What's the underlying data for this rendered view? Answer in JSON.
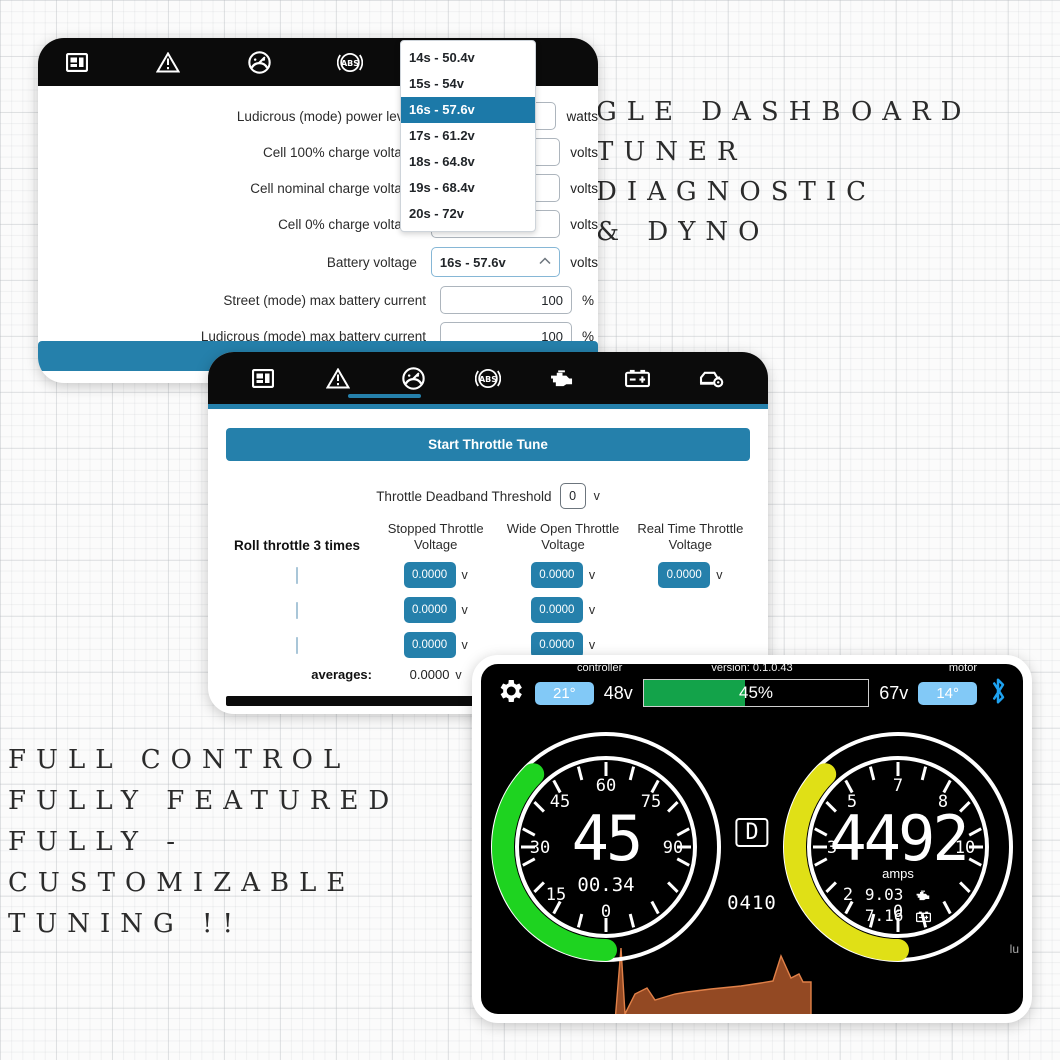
{
  "marketing": {
    "right_lines": [
      "GLE DASHBOARD",
      "TUNER",
      "DIAGNOSTIC",
      "& DYNO"
    ],
    "left_lines": [
      "FULL CONTROL",
      "FULLY FEATURED",
      "FULLY -",
      "CUSTOMIZABLE",
      "TUNING !!"
    ]
  },
  "colors": {
    "accent_blue": "#2580ab",
    "dropdown_selected": "#1c79a8",
    "gauge_green": "#1ed320",
    "gauge_yellow": "#e0e016",
    "soc_green": "#13a34a",
    "badge_blue": "#82c9f7",
    "bluetooth_blue": "#1ea2f0",
    "graph_orange": "#c4622f",
    "navbar_black": "#0b0b0b"
  },
  "settings_panel": {
    "nav_icons": [
      "dashboard-icon",
      "warning-icon",
      "gauge-icon",
      "abs-icon",
      "engine-icon"
    ],
    "rows": [
      {
        "label": "Ludicrous (mode) power level",
        "value": "",
        "unit": "watts"
      },
      {
        "label": "Cell 100% charge voltage",
        "value": "",
        "unit": "volts"
      },
      {
        "label": "Cell nominal charge voltage",
        "value": "",
        "unit": "volts"
      },
      {
        "label": "Cell 0% charge voltage",
        "value": "",
        "unit": "volts"
      },
      {
        "label": "Battery voltage",
        "value": "16s - 57.6v",
        "unit": "volts"
      },
      {
        "label": "Street (mode) max battery current",
        "value": "100",
        "unit": "%"
      },
      {
        "label": "Ludicrous (mode) max battery current",
        "value": "100",
        "unit": "%"
      }
    ],
    "dropdown": {
      "selected": "16s - 57.6v",
      "chevron": "chevron-up-icon",
      "options": [
        "14s - 50.4v",
        "15s - 54v",
        "16s - 57.6v",
        "17s - 61.2v",
        "18s - 64.8v",
        "19s - 68.4v",
        "20s - 72v"
      ]
    }
  },
  "throttle_panel": {
    "nav_icons": [
      "dashboard-icon",
      "warning-icon",
      "gauge-icon",
      "abs-icon",
      "engine-icon",
      "battery-icon",
      "car-settings-icon"
    ],
    "active_tab_index": 2,
    "start_button": "Start Throttle Tune",
    "deadband": {
      "label": "Throttle Deadband Threshold",
      "value": "0",
      "unit": "v"
    },
    "row_label": "Roll throttle 3 times",
    "columns": [
      "Stopped Throttle Voltage",
      "Wide Open Throttle Voltage",
      "Real Time Throttle Voltage"
    ],
    "rows": [
      {
        "checked": false,
        "stopped": "0.0000",
        "wot": "0.0000",
        "realtime": "0.0000"
      },
      {
        "checked": false,
        "stopped": "0.0000",
        "wot": "0.0000",
        "realtime": ""
      },
      {
        "checked": false,
        "stopped": "0.0000",
        "wot": "0.0000",
        "realtime": ""
      }
    ],
    "averages_label": "averages:",
    "averages_value": "0.0000",
    "unit": "v"
  },
  "dashboard_panel": {
    "gear_icon": "gear-icon",
    "bluetooth_icon": "bluetooth-icon",
    "caption_controller": "controller",
    "caption_version": "version: 0.1.0.43",
    "caption_motor": "motor",
    "controller_temp": "21°",
    "battery_low_volts": "48v",
    "battery_high_volts": "67v",
    "motor_temp": "14°",
    "soc_percent": "45%",
    "soc_value": 45,
    "gear": "D",
    "trip": "0410",
    "corner_text": "lu",
    "left_gauge": {
      "name": "speedometer",
      "value": "45",
      "odometer": "00.34",
      "ticks": [
        "0",
        "15",
        "30",
        "45",
        "60",
        "75",
        "90"
      ],
      "arc_percent": 50,
      "max": 90
    },
    "right_gauge": {
      "name": "ammeter",
      "value": "4492",
      "unit_label": "amps",
      "motor_amps": "9.03",
      "motor_icon": "engine-icon",
      "battery_amps": "7.16",
      "battery_icon": "battery-icon",
      "ticks": [
        "0",
        "2",
        "3",
        "5",
        "7",
        "8",
        "10"
      ],
      "arc_percent": 50,
      "max": 10
    }
  }
}
